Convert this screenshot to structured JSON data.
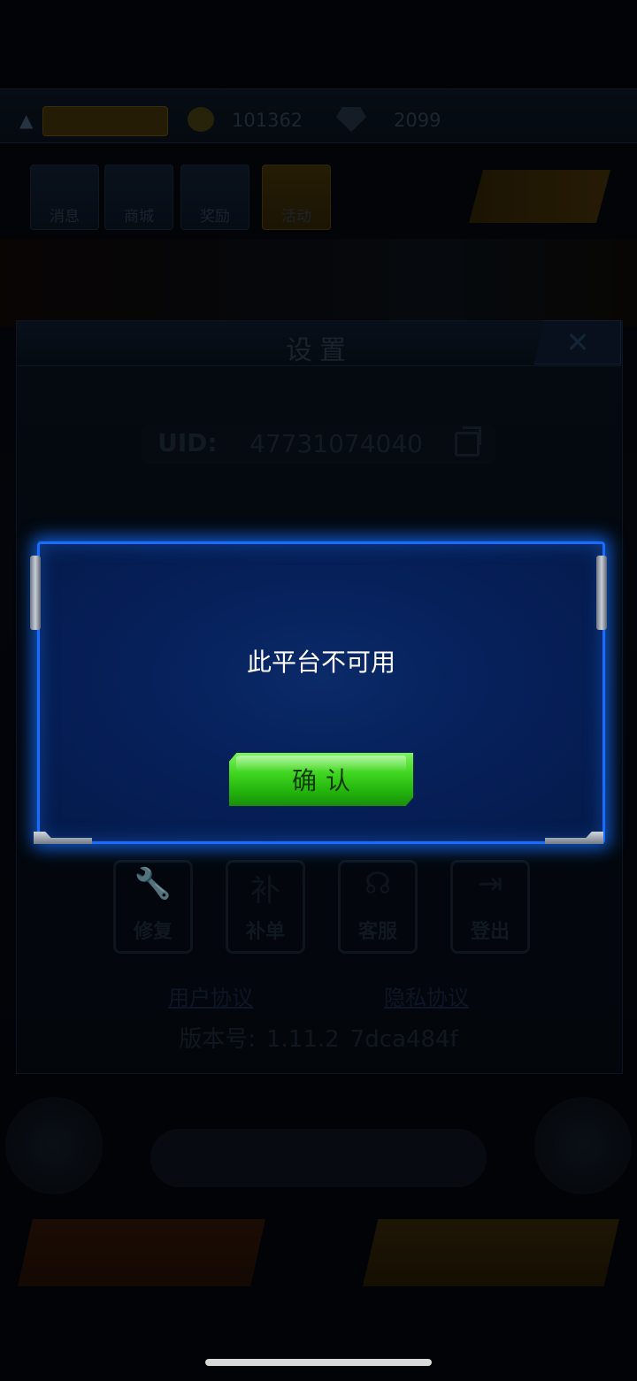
{
  "hud": {
    "gold": "101362",
    "gems": "2099",
    "shortcuts": [
      "消息",
      "商城",
      "奖励",
      "活动"
    ]
  },
  "settings": {
    "title": "设置",
    "uid_label": "UID:",
    "uid_value": "47731074040",
    "tools": [
      {
        "label": "修复",
        "glyph": "🔧",
        "icon": "wrench-icon"
      },
      {
        "label": "补单",
        "glyph": "补",
        "icon": "order-icon"
      },
      {
        "label": "客服",
        "glyph": "☊",
        "icon": "headset-icon"
      },
      {
        "label": "登出",
        "glyph": "⇥",
        "icon": "logout-icon"
      }
    ],
    "user_agreement": "用户协议",
    "privacy_agreement": "隐私协议",
    "version_label": "版本号:",
    "version_number": "1.11.2",
    "version_hash": "7dca484f"
  },
  "alert": {
    "message": "此平台不可用",
    "confirm_label": "确认"
  },
  "colors": {
    "dialog_border": "#1a6cff",
    "dialog_bg": "#06205a",
    "confirm_green": "#3fd41f"
  }
}
